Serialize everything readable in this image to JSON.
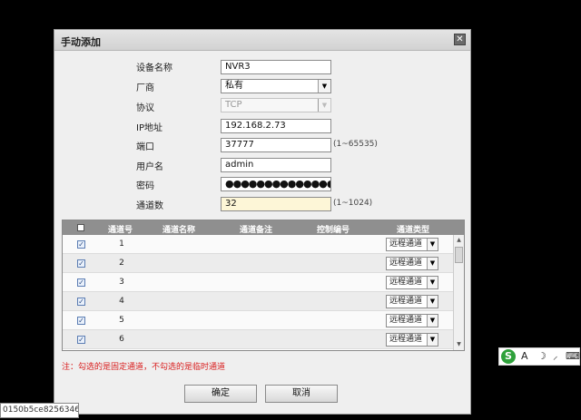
{
  "dialog": {
    "title": "手动添加",
    "close_symbol": "✕"
  },
  "form": {
    "device_name": {
      "label": "设备名称",
      "value": "NVR3"
    },
    "vendor": {
      "label": "厂商",
      "value": "私有"
    },
    "protocol": {
      "label": "协议",
      "value": "TCP"
    },
    "ip": {
      "label": "IP地址",
      "value": "192.168.2.73"
    },
    "port": {
      "label": "端口",
      "value": "37777",
      "hint": "(1~65535)"
    },
    "username": {
      "label": "用户名",
      "value": "admin"
    },
    "password": {
      "label": "密码",
      "value": "●●●●●●●●●●●●●●●●●●●●"
    },
    "channels": {
      "label": "通道数",
      "value": "32",
      "hint": "(1~1024)"
    }
  },
  "grid": {
    "columns": [
      "通道号",
      "通道名称",
      "通道备注",
      "控制编号",
      "通道类型"
    ],
    "rows": [
      {
        "checked": true,
        "number": "1",
        "type": "远程通道"
      },
      {
        "checked": true,
        "number": "2",
        "type": "远程通道"
      },
      {
        "checked": true,
        "number": "3",
        "type": "远程通道"
      },
      {
        "checked": true,
        "number": "4",
        "type": "远程通道"
      },
      {
        "checked": true,
        "number": "5",
        "type": "远程通道"
      },
      {
        "checked": true,
        "number": "6",
        "type": "远程通道"
      }
    ]
  },
  "note": "注：勾选的是固定通道，不勾选的是临时通道",
  "buttons": {
    "ok": "确定",
    "cancel": "取消"
  },
  "ime": {
    "logo": "S",
    "lang": "A",
    "moon": "☽",
    "punct": "⸝",
    "keyboard": "⌨"
  },
  "status_bar": "0150b5ce8256346...",
  "colors": {
    "header": "#8f8f8f",
    "note_red": "#d91e1e",
    "highlight": "#fdf6d7",
    "ime_green": "#2fa13b"
  }
}
